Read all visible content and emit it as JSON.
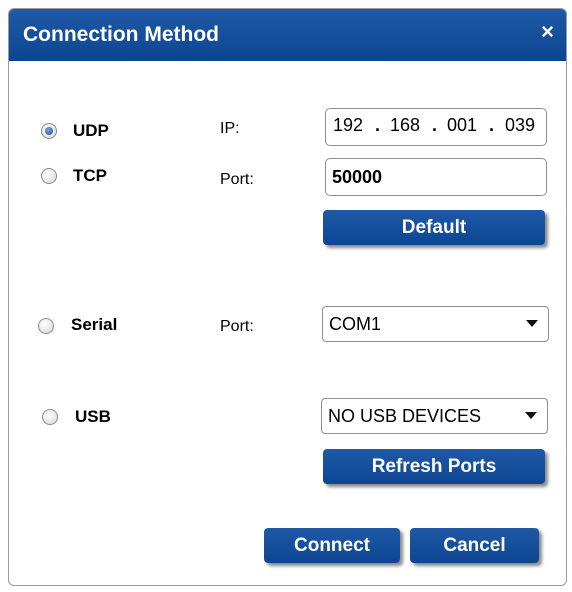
{
  "dialog": {
    "title": "Connection Method",
    "close_glyph": "×"
  },
  "udp": {
    "label": "UDP",
    "selected": true,
    "ip_label": "IP:",
    "ip_octets": [
      "192",
      "168",
      "001",
      "039"
    ]
  },
  "tcp": {
    "label": "TCP",
    "port_label": "Port:",
    "port_value": "50000",
    "default_button": "Default"
  },
  "serial": {
    "label": "Serial",
    "port_label": "Port:",
    "port_selected": "COM1"
  },
  "usb": {
    "label": "USB",
    "device_selected": "NO USB DEVICES",
    "refresh_button": "Refresh Ports"
  },
  "actions": {
    "connect": "Connect",
    "cancel": "Cancel"
  },
  "colors": {
    "accent": "#0d4592",
    "title_text": "#ffffff"
  }
}
